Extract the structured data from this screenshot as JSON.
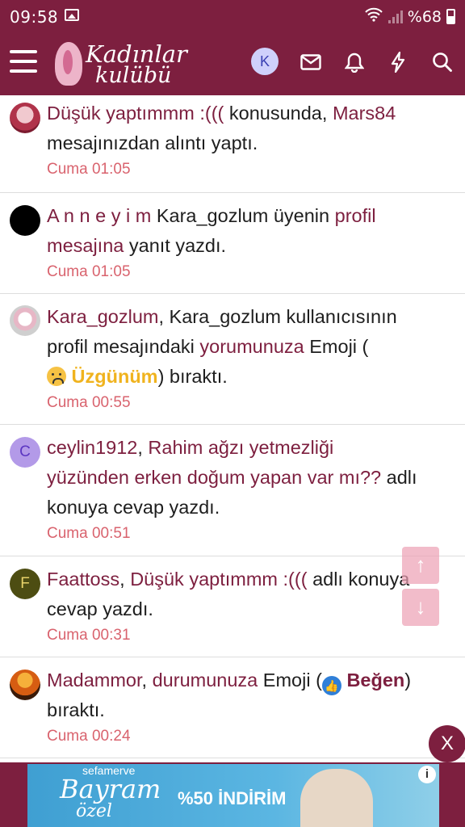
{
  "status_bar": {
    "time": "09:58",
    "battery": "%68"
  },
  "header": {
    "logo_line1": "Kadınlar",
    "logo_line2": "kulübü",
    "avatar_letter": "K"
  },
  "feed": [
    {
      "avatar": "photo-pink",
      "parts": [
        {
          "t": "Düşük yaptımmm :(((",
          "link": true
        },
        {
          "t": " konusunda, ",
          "link": false
        },
        {
          "t": "Mars84",
          "link": true
        }
      ],
      "line2": "mesajınızdan alıntı yaptı.",
      "time": "Cuma 01:05"
    },
    {
      "avatar": "black-circle",
      "parts": [
        {
          "t": "A n n e y i m",
          "link": true
        },
        {
          "t": " Kara_gozlum üyenin ",
          "link": false
        },
        {
          "t": "profil",
          "link": true
        }
      ],
      "line2_parts": [
        {
          "t": "mesajına",
          "link": true
        },
        {
          "t": " yanıt yazdı.",
          "link": false
        }
      ],
      "time": "Cuma 01:05"
    },
    {
      "avatar": "photo-cartoon",
      "parts": [
        {
          "t": "Kara_gozlum",
          "link": true
        },
        {
          "t": ", Kara_gozlum kullanıcısının",
          "link": false
        }
      ],
      "line2_parts": [
        {
          "t": "profil mesajındaki ",
          "link": false
        },
        {
          "t": "yorumunuza",
          "link": true
        },
        {
          "t": " Emoji (",
          "link": false
        }
      ],
      "reaction_label": "Üzgünüm",
      "line3_suffix": ") bıraktı.",
      "time": "Cuma 00:55"
    },
    {
      "avatar_letter": "C",
      "parts": [
        {
          "t": "ceylin1912",
          "link": true
        },
        {
          "t": ", ",
          "link": false
        },
        {
          "t": "Rahim ağzı yetmezliği",
          "link": true
        }
      ],
      "line2_parts": [
        {
          "t": "yüzünden erken doğum yapan var mı??",
          "link": true
        },
        {
          "t": " adlı",
          "link": false
        }
      ],
      "line3": "konuya cevap yazdı.",
      "time": "Cuma 00:51"
    },
    {
      "avatar_letter": "F",
      "parts": [
        {
          "t": "Faattoss",
          "link": true
        },
        {
          "t": ", ",
          "link": false
        },
        {
          "t": "Düşük yaptımmm :(((",
          "link": true
        },
        {
          "t": " adlı konuya",
          "link": false
        }
      ],
      "line2": "cevap yazdı.",
      "time": "Cuma 00:31"
    },
    {
      "avatar": "photo-sunset",
      "parts": [
        {
          "t": "Madammor",
          "link": true
        },
        {
          "t": ", ",
          "link": false
        },
        {
          "t": "durumunuza",
          "link": true
        },
        {
          "t": " Emoji (",
          "link": false
        }
      ],
      "reaction_label": "Beğen",
      "line1_suffix": ")",
      "line2": "bıraktı.",
      "time": "Cuma 00:24"
    }
  ],
  "scroll": {
    "up": "↑",
    "down": "↓"
  },
  "ad": {
    "brand": "sefamerve",
    "line1": "Bayram",
    "line2": "özel",
    "offer": "%50 İNDİRİM",
    "close": "X",
    "info": "i"
  },
  "colors": {
    "brand": "#7d1f3f",
    "time": "#d9636e"
  }
}
